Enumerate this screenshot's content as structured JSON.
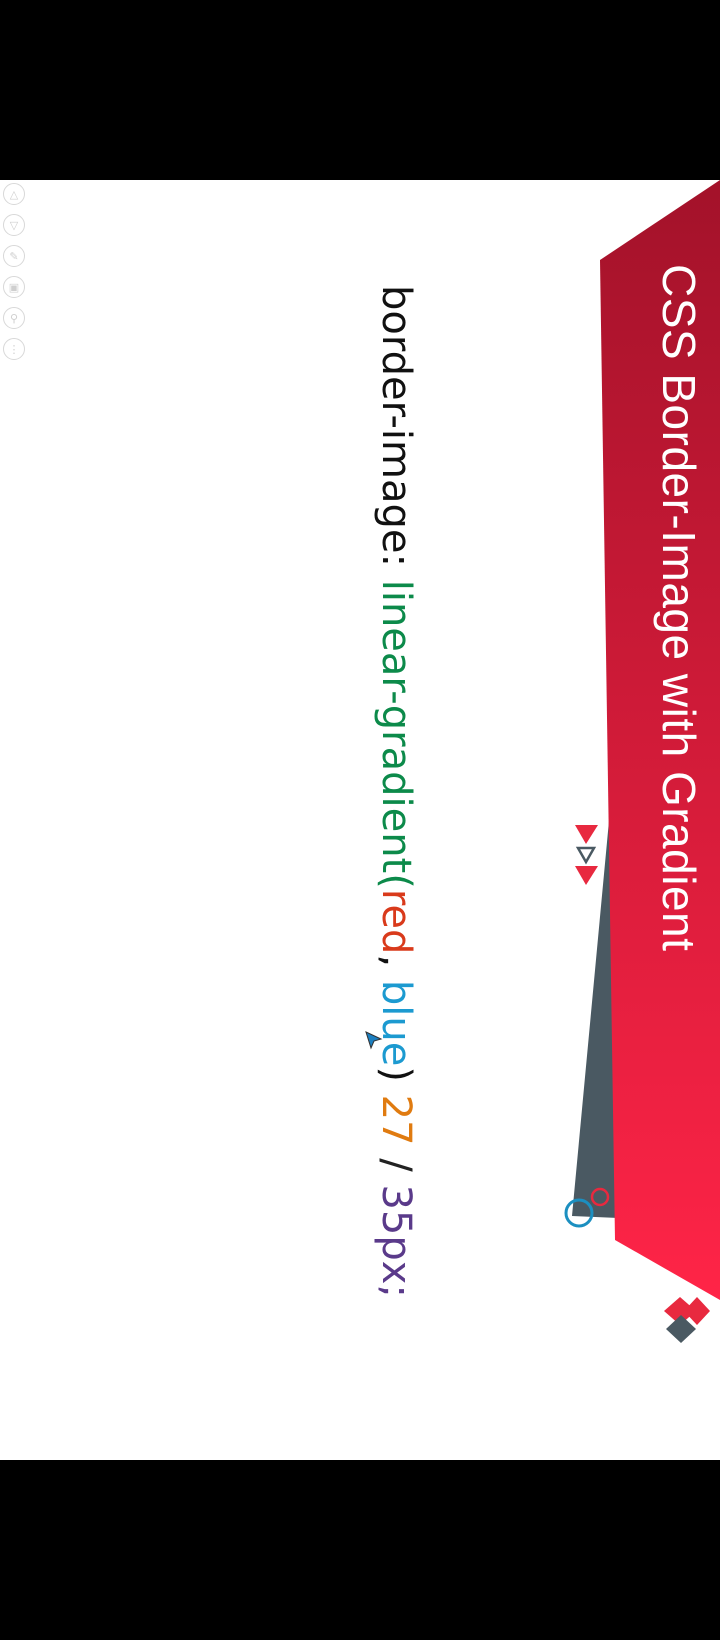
{
  "slide": {
    "title": "CSS Border-Image with Gradient",
    "code": {
      "property": "border-image: ",
      "function": "linear-gradient(",
      "color1": "red",
      "sep": ", ",
      "color2": "blue",
      "close": ") ",
      "slice": "27",
      "slash": " / ",
      "width": "35px;"
    }
  },
  "toolbar": {
    "icons": [
      "up-arrow-icon",
      "down-arrow-icon",
      "pen-icon",
      "layout-icon",
      "zoom-icon",
      "more-icon"
    ]
  },
  "colors": {
    "banner_dark": "#a3122a",
    "banner_light": "#ff2447",
    "accent_gray": "#4a5962",
    "accent_blue": "#1c8fc0"
  }
}
